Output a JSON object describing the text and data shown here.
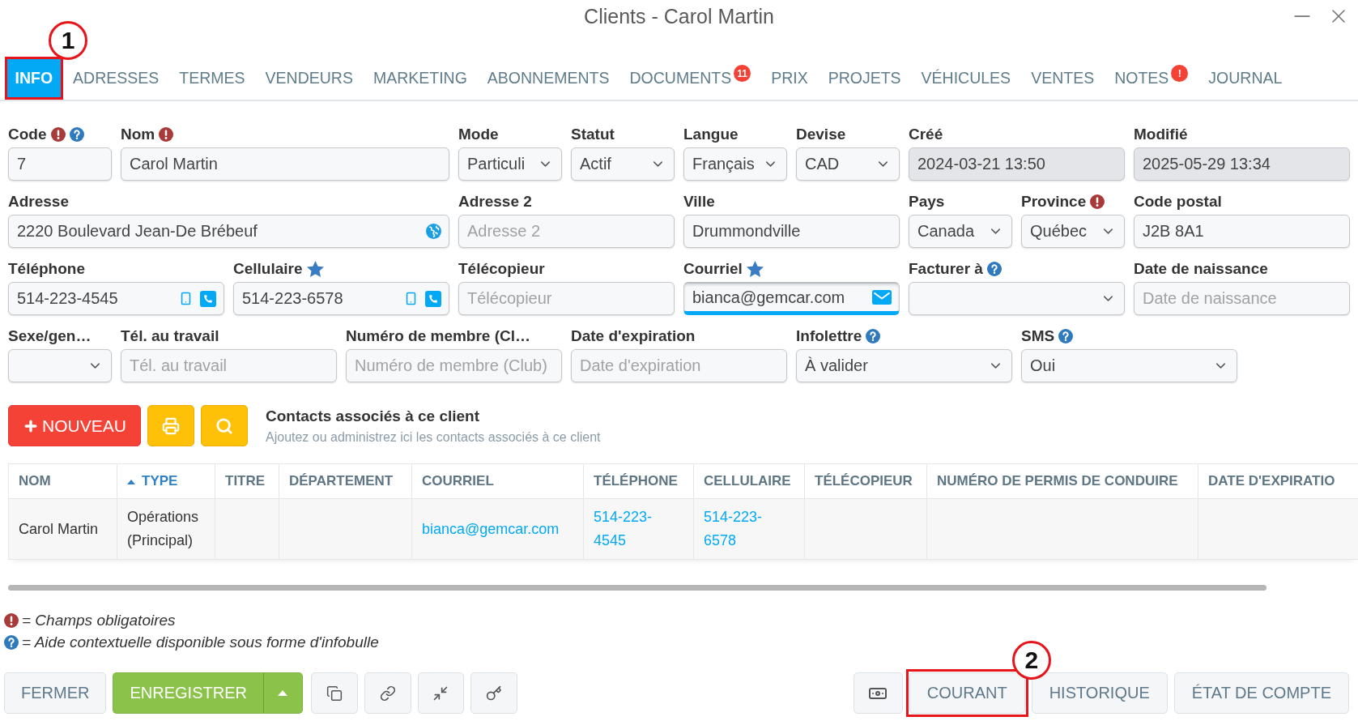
{
  "window": {
    "title": "Clients - Carol Martin"
  },
  "tabs": [
    {
      "label": "INFO",
      "selected": true,
      "callout": "1"
    },
    {
      "label": "ADRESSES",
      "selected": false
    },
    {
      "label": "TERMES",
      "selected": false
    },
    {
      "label": "VENDEURS",
      "selected": false
    },
    {
      "label": "MARKETING",
      "selected": false
    },
    {
      "label": "ABONNEMENTS",
      "selected": false
    },
    {
      "label": "DOCUMENTS",
      "selected": false,
      "badge": "11"
    },
    {
      "label": "PRIX",
      "selected": false
    },
    {
      "label": "PROJETS",
      "selected": false
    },
    {
      "label": "VÉHICULES",
      "selected": false
    },
    {
      "label": "VENTES",
      "selected": false
    },
    {
      "label": "NOTES",
      "selected": false,
      "badge": "!"
    },
    {
      "label": "JOURNAL",
      "selected": false
    }
  ],
  "form": {
    "fields": [
      {
        "label": "Code",
        "required": true,
        "help": true,
        "starred": false,
        "kind": "text",
        "value": "7",
        "focused": false
      },
      {
        "label": "Nom",
        "required": true,
        "help": false,
        "starred": false,
        "kind": "text",
        "value": "Carol Martin",
        "focused": false
      },
      {
        "label": "Mode",
        "required": false,
        "help": false,
        "starred": false,
        "kind": "select",
        "value": "Particuli",
        "focused": false
      },
      {
        "label": "Statut",
        "required": false,
        "help": false,
        "starred": false,
        "kind": "select",
        "value": "Actif",
        "focused": false
      },
      {
        "label": "Langue",
        "required": false,
        "help": false,
        "starred": false,
        "kind": "select",
        "value": "Français",
        "focused": false
      },
      {
        "label": "Devise",
        "required": false,
        "help": false,
        "starred": false,
        "kind": "select",
        "value": "CAD",
        "focused": false
      },
      {
        "label": "Créé",
        "required": false,
        "help": false,
        "starred": false,
        "kind": "readonly",
        "value": "2024-03-21 13:50",
        "focused": false
      },
      {
        "label": "Modifié",
        "required": false,
        "help": false,
        "starred": false,
        "kind": "readonly",
        "value": "2025-05-29 13:34",
        "focused": false
      },
      {
        "label": "Adresse",
        "required": false,
        "help": false,
        "starred": false,
        "kind": "address",
        "value": "2220 Boulevard Jean-De Brébeuf",
        "focused": false
      },
      {
        "label": "Adresse 2",
        "required": false,
        "help": false,
        "starred": false,
        "kind": "text",
        "placeholder": "Adresse 2",
        "focused": false
      },
      {
        "label": "Ville",
        "required": false,
        "help": false,
        "starred": false,
        "kind": "text",
        "value": "Drummondville",
        "focused": false
      },
      {
        "label": "Pays",
        "required": false,
        "help": false,
        "starred": false,
        "kind": "select",
        "value": "Canada",
        "focused": false
      },
      {
        "label": "Province",
        "required": true,
        "help": false,
        "starred": false,
        "kind": "select",
        "value": "Québec",
        "focused": false
      },
      {
        "label": "Code postal",
        "required": false,
        "help": false,
        "starred": false,
        "kind": "text",
        "value": "J2B 8A1",
        "focused": false
      },
      {
        "label": "Téléphone",
        "required": false,
        "help": false,
        "starred": false,
        "kind": "phone",
        "value": "514-223-4545",
        "focused": false
      },
      {
        "label": "Cellulaire",
        "required": false,
        "help": false,
        "starred": true,
        "kind": "phone",
        "value": "514-223-6578",
        "focused": false
      },
      {
        "label": "Télécopieur",
        "required": false,
        "help": false,
        "starred": false,
        "kind": "text",
        "placeholder": "Télécopieur",
        "focused": false
      },
      {
        "label": "Courriel",
        "required": false,
        "help": false,
        "starred": true,
        "kind": "email",
        "value": "bianca@gemcar.com",
        "focused": true
      },
      {
        "label": "Facturer à",
        "required": false,
        "help": true,
        "starred": false,
        "kind": "select",
        "focused": false
      },
      {
        "label": "Date de naissance",
        "required": false,
        "help": false,
        "starred": false,
        "kind": "text",
        "placeholder": "Date de naissance",
        "focused": false
      },
      {
        "label": "Sexe/gen…",
        "required": false,
        "help": false,
        "starred": false,
        "kind": "select",
        "focused": false
      },
      {
        "label": "Tél. au travail",
        "required": false,
        "help": false,
        "starred": false,
        "kind": "text",
        "placeholder": "Tél. au travail",
        "focused": false
      },
      {
        "label": "Numéro de membre (Cl…",
        "required": false,
        "help": false,
        "starred": false,
        "kind": "text",
        "placeholder": "Numéro de membre (Club)",
        "focused": false
      },
      {
        "label": "Date d'expiration",
        "required": false,
        "help": false,
        "starred": false,
        "kind": "text",
        "placeholder": "Date d'expiration",
        "focused": false
      },
      {
        "label": "Infolettre",
        "required": false,
        "help": true,
        "starred": false,
        "kind": "select",
        "value": "À valider",
        "focused": false
      },
      {
        "label": "SMS",
        "required": false,
        "help": true,
        "starred": false,
        "kind": "select",
        "value": "Oui",
        "focused": false
      }
    ]
  },
  "contacts": {
    "new_label": "NOUVEAU",
    "title": "Contacts associés à ce client",
    "subtitle": "Ajoutez ou administrez ici les contacts associés à ce client"
  },
  "table": {
    "columns": [
      {
        "label": "NOM",
        "kind": "text",
        "sorted": false
      },
      {
        "label": "TYPE",
        "kind": "text",
        "sorted": true
      },
      {
        "label": "TITRE",
        "kind": "text",
        "sorted": false
      },
      {
        "label": "DÉPARTEMENT",
        "kind": "text",
        "sorted": false
      },
      {
        "label": "COURRIEL",
        "kind": "email",
        "sorted": false
      },
      {
        "label": "TÉLÉPHONE",
        "kind": "phone",
        "sorted": false
      },
      {
        "label": "CELLULAIRE",
        "kind": "phone",
        "sorted": false
      },
      {
        "label": "TÉLÉCOPIEUR",
        "kind": "phone",
        "sorted": false
      },
      {
        "label": "NUMÉRO DE PERMIS DE CONDUIRE",
        "kind": "text",
        "sorted": false
      },
      {
        "label": "DATE D'EXPIRATIO",
        "kind": "text",
        "sorted": false
      }
    ],
    "rows": [
      {
        "cells": [
          "Carol Martin",
          "Opérations (Principal)",
          null,
          null,
          "bianca@gemcar.com",
          "514-223-4545",
          "514-223-6578",
          null,
          null,
          null
        ]
      }
    ]
  },
  "legend": [
    {
      "kind": "required",
      "text": "= Champs obligatoires"
    },
    {
      "kind": "help",
      "text": "= Aide contextuelle disponible sous forme d'infobulle"
    }
  ],
  "footer": {
    "close_label": "FERMER",
    "save_label": "ENREGISTRER",
    "account_buttons": [
      {
        "label": "COURANT",
        "callout": "2"
      },
      {
        "label": "HISTORIQUE"
      },
      {
        "label": "ÉTAT DE COMPTE"
      }
    ]
  }
}
